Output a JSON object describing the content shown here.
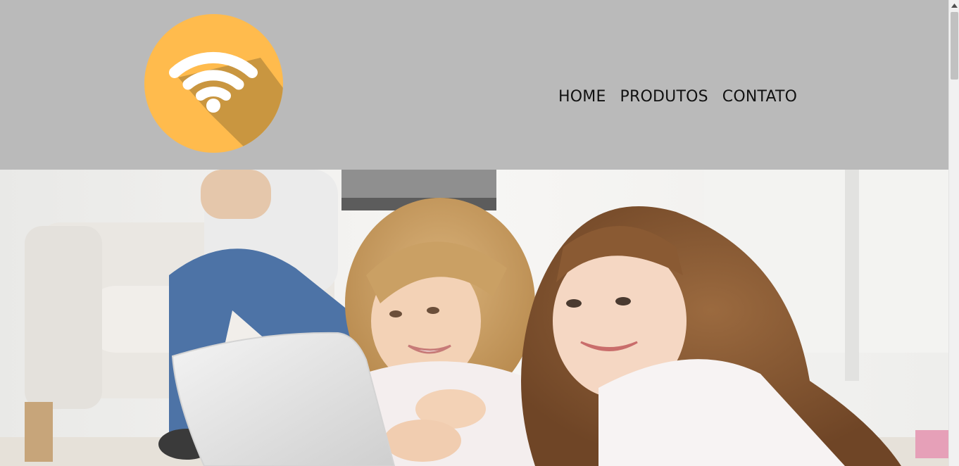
{
  "header": {
    "logo": {
      "icon": "wifi-icon",
      "circle_color": "#ffbb4d",
      "shadow_color": "#c99640"
    },
    "background_color": "#bababa"
  },
  "nav": {
    "items": [
      {
        "label": "HOME"
      },
      {
        "label": "PRODUTOS"
      },
      {
        "label": "CONTATO"
      }
    ]
  },
  "hero": {
    "image": "two-smiling-girls-with-tablet-photo"
  },
  "scrollbar": {
    "position_fraction": 0.0
  }
}
